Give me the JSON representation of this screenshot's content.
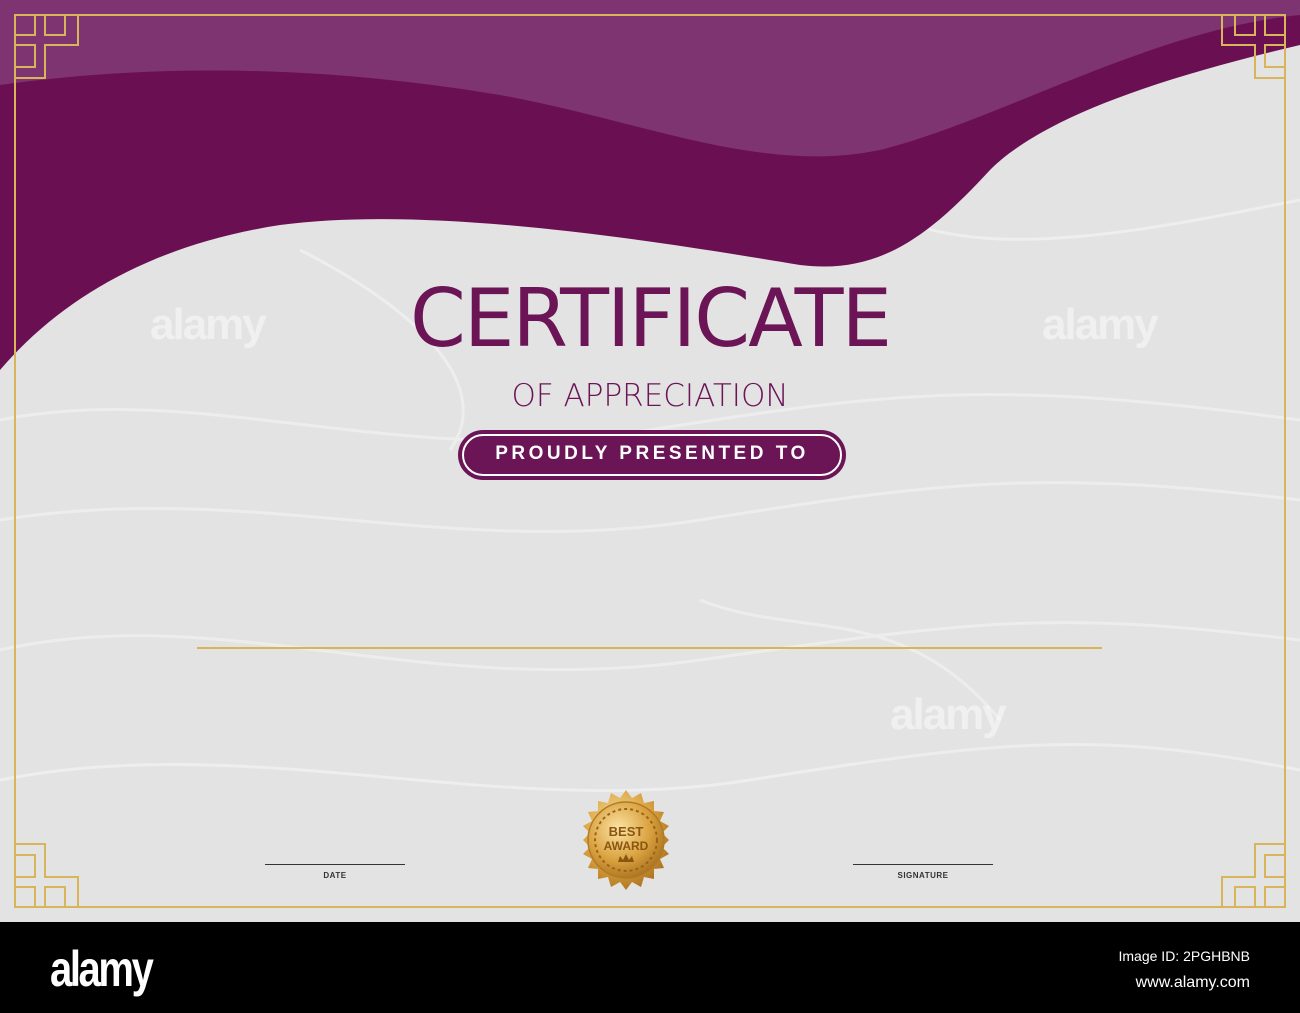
{
  "certificate": {
    "title": "CERTIFICATE",
    "subtitle": "OF APPRECIATION",
    "presented_label": "PROUDLY PRESENTED TO",
    "date_label": "DATE",
    "signature_label": "SIGNATURE",
    "seal": {
      "line1": "BEST",
      "line2": "AWARD"
    },
    "colors": {
      "purple": "#6b1456",
      "purple_light": "#7e3470",
      "gold": "#d8b45a",
      "background": "#e3e3e3"
    }
  },
  "watermark": {
    "text": "alamy"
  },
  "footer": {
    "logo": "alamy",
    "image_id": "Image ID: 2PGHBNB",
    "url": "www.alamy.com"
  }
}
